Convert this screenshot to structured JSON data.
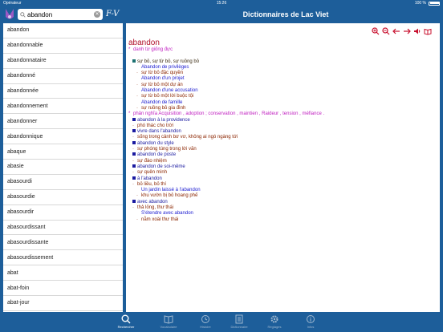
{
  "status_bar": {
    "carrier": "Opérateur",
    "time": "15:26",
    "battery": "100 %"
  },
  "header": {
    "search_value": "abandon",
    "direction": "F-V",
    "title": "Dictionnaires de Lac Viet"
  },
  "word_list": [
    "abandon",
    "abandonnable",
    "abandonnataire",
    "abandonné",
    "abandonnée",
    "abandonnement",
    "abandonner",
    "abandonnique",
    "abaque",
    "abasie",
    "abasourdi",
    "abasourdie",
    "abasourdir",
    "abasourdissant",
    "abasourdissante",
    "abasourdissement",
    "abat",
    "abat-foin",
    "abat-jour",
    "abat-son"
  ],
  "definition": {
    "headword": "abandon",
    "lines": [
      {
        "marker": "*",
        "text": "danh từ giống đực",
        "indent": 0,
        "style": "mag"
      },
      {
        "marker": "",
        "text": "",
        "indent": 0,
        "style": "dark"
      },
      {
        "marker": "sqteal",
        "text": "sự bỏ, sự từ bỏ, sự ruồng bỏ",
        "indent": 1,
        "style": "dark"
      },
      {
        "marker": "",
        "text": "Abandon de privilèges",
        "indent": 2,
        "style": "blue"
      },
      {
        "marker": "·",
        "text": "sự từ bỏ đặc quyền",
        "indent": 2,
        "style": "brown"
      },
      {
        "marker": "",
        "text": "Abandon d'un projet",
        "indent": 2,
        "style": "blue"
      },
      {
        "marker": "·",
        "text": "sự từ bỏ một dự án",
        "indent": 2,
        "style": "brown"
      },
      {
        "marker": "",
        "text": "Abandon d'une accusation",
        "indent": 2,
        "style": "blue"
      },
      {
        "marker": "·",
        "text": "sự từ bỏ một lời buộc tội",
        "indent": 2,
        "style": "brown"
      },
      {
        "marker": "",
        "text": "Abandon de famille",
        "indent": 2,
        "style": "blue"
      },
      {
        "marker": "·",
        "text": "sự ruồng bỏ gia đình",
        "indent": 2,
        "style": "brown"
      },
      {
        "marker": "*",
        "text": "phản nghĩa Acquisition , adoption ; conservation , maintien , Raideur , tension , méfiance .",
        "indent": 0,
        "style": "mag"
      },
      {
        "marker": "sq",
        "text": "abandon à la providence",
        "indent": 1,
        "style": "navy"
      },
      {
        "marker": "·",
        "text": "phó thác cho trời",
        "indent": 1,
        "style": "brown"
      },
      {
        "marker": "sq",
        "text": "vivre dans l'abandon",
        "indent": 1,
        "style": "navy"
      },
      {
        "marker": "·",
        "text": "sống trong cảnh bơ vơ, không ai ngó ngàng tới",
        "indent": 1,
        "style": "brown"
      },
      {
        "marker": "sq",
        "text": "abandon du style",
        "indent": 1,
        "style": "navy"
      },
      {
        "marker": "·",
        "text": "sự phóng túng trong lời văn",
        "indent": 1,
        "style": "brown"
      },
      {
        "marker": "sq",
        "text": "abandon de poste",
        "indent": 1,
        "style": "navy"
      },
      {
        "marker": "·",
        "text": "sự đào nhiệm",
        "indent": 1,
        "style": "brown"
      },
      {
        "marker": "sq",
        "text": "abandon de soi-même",
        "indent": 1,
        "style": "navy"
      },
      {
        "marker": "·",
        "text": "sự quên mình",
        "indent": 1,
        "style": "brown"
      },
      {
        "marker": "sq",
        "text": "à l'abandon",
        "indent": 1,
        "style": "navy"
      },
      {
        "marker": "·",
        "text": "bỏ liều, bỏ thí",
        "indent": 1,
        "style": "brown"
      },
      {
        "marker": "",
        "text": "Un jardin laissé à l'abandon",
        "indent": 2,
        "style": "blue"
      },
      {
        "marker": "·",
        "text": "khu vườn bị bỏ hoang phế",
        "indent": 2,
        "style": "brown"
      },
      {
        "marker": "sq",
        "text": "avec abandon",
        "indent": 1,
        "style": "navy"
      },
      {
        "marker": "·",
        "text": "thả lỏng, thư thái",
        "indent": 1,
        "style": "brown"
      },
      {
        "marker": "",
        "text": "S'étendre avec abandon",
        "indent": 2,
        "style": "blue"
      },
      {
        "marker": "·",
        "text": "nằm xoài thư thái",
        "indent": 2,
        "style": "brown"
      }
    ]
  },
  "toolbar_icons": [
    "zoom-in-icon",
    "zoom-out-icon",
    "back-arrow-icon",
    "forward-arrow-icon",
    "speaker-icon",
    "book-icon"
  ],
  "tabs": [
    {
      "label": "Rechercher",
      "icon": "search-icon",
      "active": true
    },
    {
      "label": "Vocabulaire",
      "icon": "bookmark-icon",
      "active": false
    },
    {
      "label": "Histoire",
      "icon": "history-icon",
      "active": false
    },
    {
      "label": "Dictionnaire",
      "icon": "dictionary-icon",
      "active": false
    },
    {
      "label": "Réglages",
      "icon": "gear-icon",
      "active": false
    },
    {
      "label": "Infos",
      "icon": "info-icon",
      "active": false
    }
  ],
  "colors": {
    "bar": "#1d5e9a",
    "accent": "#c8102e",
    "headword": "#b0102a"
  }
}
